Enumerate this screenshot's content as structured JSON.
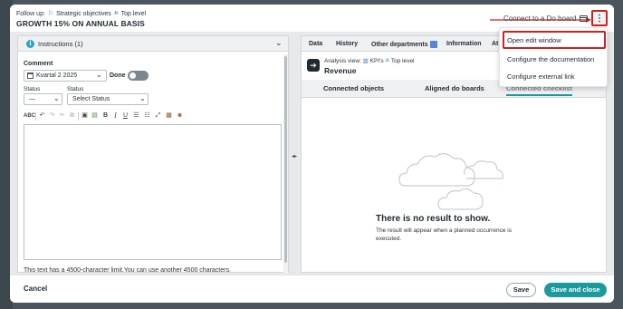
{
  "header": {
    "follow_prefix": "Follow up:",
    "follow_link1": "Strategic objectives",
    "follow_link2": "Top level",
    "title": "GROWTH 15% ON ANNUAL BASIS",
    "connect_label": "Connect to a Do board",
    "more_label": "⋮"
  },
  "menu": {
    "items": [
      "Open edit window",
      "Configure the documentation",
      "Configure external link"
    ]
  },
  "left": {
    "instructions_label": "Instructions (1)",
    "comment_label": "Comment",
    "period_value": "Kvartal 2 2025",
    "done_label": "Done",
    "status1_label": "Status",
    "status1_value": "—",
    "status2_label": "Status",
    "status2_placeholder": "Select Status",
    "limit_text": "This text has a 4500-character limit.You can use another 4500 characters."
  },
  "right": {
    "tabs": [
      "Data",
      "History",
      "Other departments",
      "Information",
      "At"
    ],
    "analysis_view": "Analysis view:",
    "analysis_kpi": "KPI's",
    "analysis_level": "Top level",
    "analysis_title": "Revenue",
    "subtabs": [
      "Connected objects",
      "Aligned do boards",
      "Connected checklist"
    ],
    "empty_title": "There is no result to show.",
    "empty_sub": "The result will appear when a planned occurrence is executed."
  },
  "footer": {
    "cancel": "Cancel",
    "save": "Save",
    "save_close": "Save and close"
  },
  "colors": {
    "accent": "#1a9a9c",
    "highlight": "#d21f1f"
  }
}
